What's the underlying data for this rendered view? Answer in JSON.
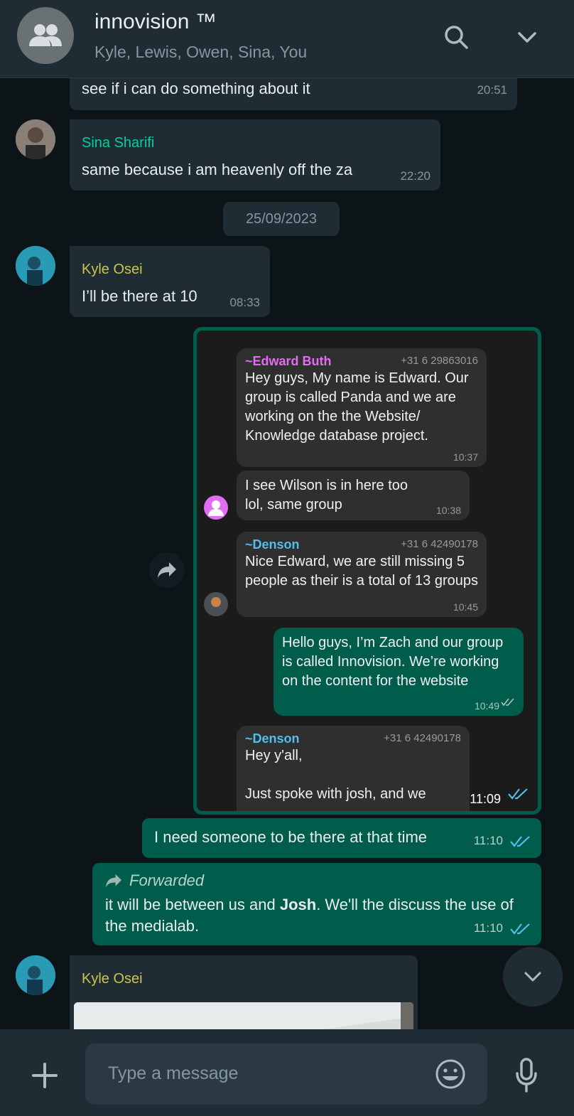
{
  "header": {
    "title": "innovision ™",
    "members": "Kyle, Lewis, Owen, Sina, You"
  },
  "messages": {
    "m0": {
      "text": "see if i can do something about it",
      "time": "20:51"
    },
    "m1": {
      "sender": "Sina Sharifi",
      "text": "same because i am heavenly off the za",
      "time": "22:20"
    },
    "date_divider": "25/09/2023",
    "m2": {
      "sender": "Kyle Osei",
      "text": "I’ll be there at 10",
      "time": "08:33"
    },
    "m3": {
      "time": "11:09",
      "embedded": {
        "e1": {
          "name": "~Edward Buth",
          "phone": "+31 6 29863016",
          "text": "Hey guys, My name is Edward. Our group is called Panda and we are working on the the Website/ Knowledge database project.",
          "time": "10:37"
        },
        "e2": {
          "text": "I see Wilson is in here too lol, same group",
          "time": "10:38"
        },
        "e3": {
          "name": "~Denson",
          "phone": "+31 6 42490178",
          "text": "Nice Edward, we are still missing 5 people as their is a total of 13 groups",
          "time": "10:45"
        },
        "e4": {
          "text": "Hello guys, I’m Zach and our group is called Innovision. We’re working on the content for the website",
          "time": "10:49"
        },
        "e5": {
          "name": "~Denson",
          "phone": "+31 6 42490178",
          "text1": "Hey y'all,",
          "text2": "Just spoke with josh, and we"
        }
      }
    },
    "m4": {
      "text": "I need someone to be there at that time",
      "time": "11:10"
    },
    "m5": {
      "forwarded_label": "Forwarded",
      "text_before": "it will be between us and ",
      "text_bold": "Josh",
      "text_after": ". We'll the discuss the use of the medialab.",
      "time": "11:10"
    },
    "m6": {
      "sender": "Kyle Osei"
    }
  },
  "composer": {
    "placeholder": "Type a message"
  },
  "colors": {
    "accent_green": "#005c4b",
    "sina_name": "#06cf9c",
    "kyle_name": "#c9c54d",
    "edward_name": "#e36df2",
    "denson_name": "#53bdeb",
    "read_ticks": "#53bdeb"
  },
  "icons": [
    "group-avatar-icon",
    "search-icon",
    "chevron-down-icon",
    "forward-icon",
    "scroll-down-icon",
    "plus-icon",
    "emoji-icon",
    "mic-icon",
    "double-check-icon"
  ]
}
